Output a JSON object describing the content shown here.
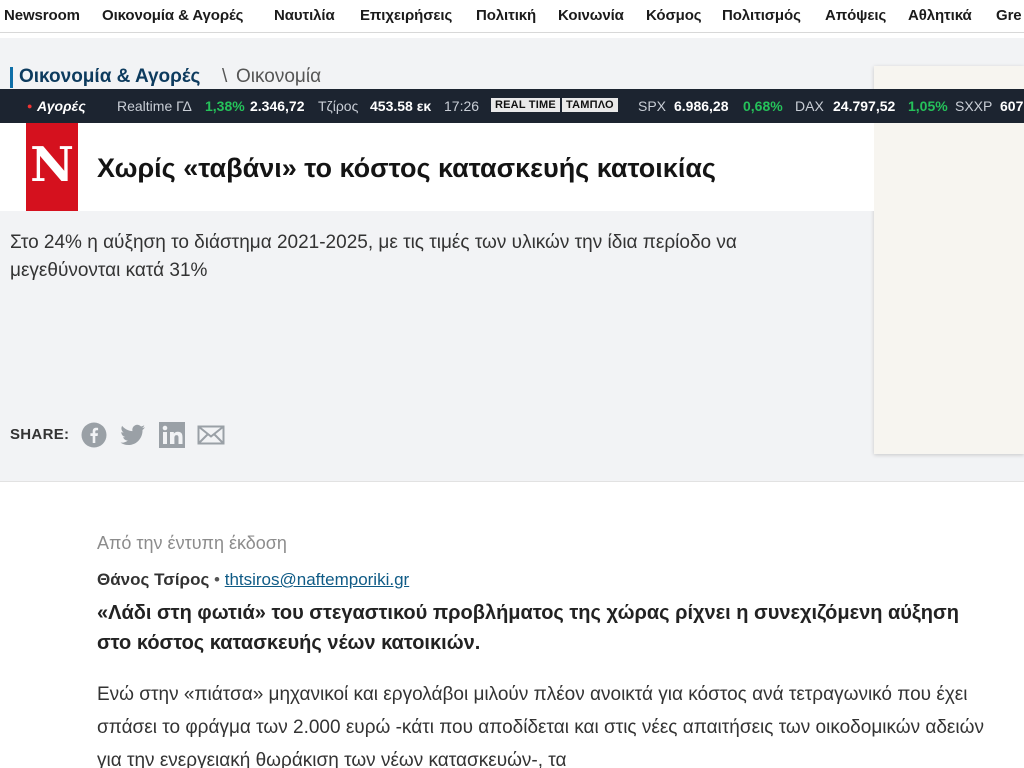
{
  "topnav": {
    "items": [
      "Newsroom",
      "Οικονομία & Αγορές",
      "Ναυτιλία",
      "Επιχειρήσεις",
      "Πολιτική",
      "Κοινωνία",
      "Κόσμος",
      "Πολιτισμός",
      "Απόψεις",
      "Αθλητικά",
      "Gre"
    ]
  },
  "breadcrumb": {
    "section": "Οικονομία & Αγορές",
    "separator": "\\",
    "subsection": "Οικονομία"
  },
  "ticker": {
    "label": "Αγορές",
    "realtime_label": "Realtime ΓΔ",
    "gd_change": "1,38%",
    "gd_value": "2.346,72",
    "turnover_label": "Τζίρος",
    "turnover_value": "453.58 εκ",
    "time": "17:26",
    "realtime_button": "REAL TIME",
    "board_button": "ΤΑΜΠΛΟ",
    "spx_label": "SPX",
    "spx_value": "6.986,28",
    "spx_change": "0,68%",
    "dax_label": "DAX",
    "dax_value": "24.797,52",
    "dax_change": "1,05%",
    "sxxp_label": "SXXP",
    "sxxp_value": "607"
  },
  "logo": {
    "letter": "N"
  },
  "article": {
    "title": "Χωρίς «ταβάνι» το κόστος κατασκευής κατοικίας",
    "subtitle": "Στο 24% η αύξηση το διάστημα 2021-2025, με τις τιμές των υλικών την ίδια περίοδο να μεγεθύνονται κατά 31%",
    "share_label": "SHARE:",
    "print_edition": "Από την έντυπη έκδοση",
    "author": "Θάνος Τσίρος",
    "bullet": "•",
    "email": "thtsiros@naftemporiki.gr",
    "lead": "«Λάδι στη φωτιά» του στεγαστικού προβλήματος της χώρας ρίχνει η συνεχιζόμενη αύξηση στο κόστος κατασκευής νέων κατοικιών.",
    "body": "Ενώ στην «πιάτσα» μηχανικοί και εργολάβοι μιλούν πλέον ανοικτά για κόστος ανά τετραγωνικό που έχει σπάσει το φράγμα των 2.000 ευρώ -κάτι που αποδίδεται και στις νέες απαιτήσεις των οικοδομικών αδειών για την ενεργειακή θωράκιση των νέων κατασκευών-, τα"
  },
  "colors": {
    "ticker_bg": "#1c2430",
    "positive": "#25c25a",
    "logo_red": "#d5111e",
    "breadcrumb_accent": "#0f6fa8",
    "hero_bg": "#f2f3f5"
  },
  "icons": {
    "share": [
      "facebook-icon",
      "twitter-icon",
      "linkedin-icon",
      "mail-icon"
    ]
  }
}
